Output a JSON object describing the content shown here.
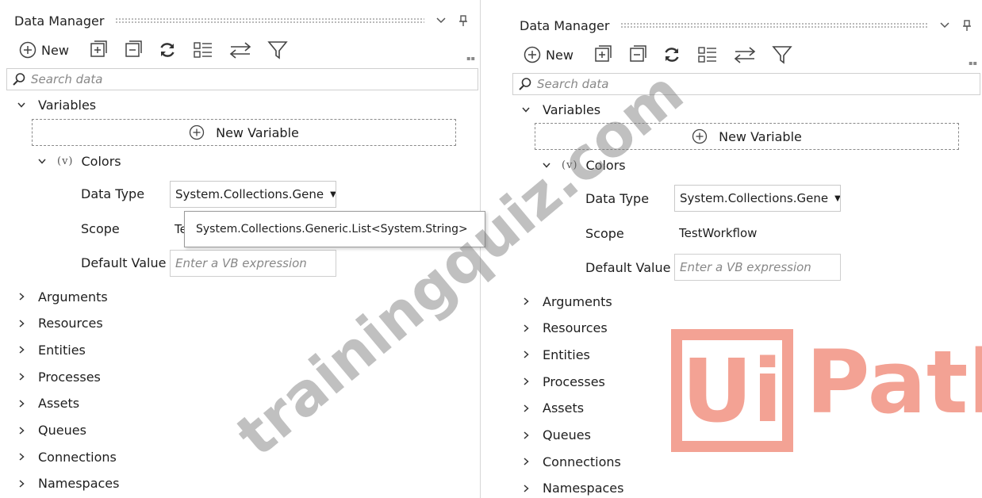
{
  "panel_title": "Data Manager",
  "toolbar": {
    "new_label": "New"
  },
  "search": {
    "placeholder": "Search data"
  },
  "tree": {
    "variables": "Variables",
    "new_variable": "New Variable",
    "variable_badge": "(v)",
    "variable_name": "Colors",
    "data_type_label": "Data Type",
    "data_type_value": "System.Collections.Gene",
    "scope_label": "Scope",
    "scope_value": "TestWorkflow",
    "scope_value_truncated": "Te",
    "default_value_label": "Default Value",
    "default_value_placeholder": "Enter a VB expression",
    "sections": [
      "Arguments",
      "Resources",
      "Entities",
      "Processes",
      "Assets",
      "Queues",
      "Connections",
      "Namespaces"
    ]
  },
  "tooltip": "System.Collections.Generic.List<System.String>",
  "watermark": "trainingquiz.com",
  "logo": {
    "box_text": "Ui",
    "rest_text": "Path"
  },
  "colors": {
    "logo": "#f3a294",
    "border": "#cfcfcf"
  }
}
